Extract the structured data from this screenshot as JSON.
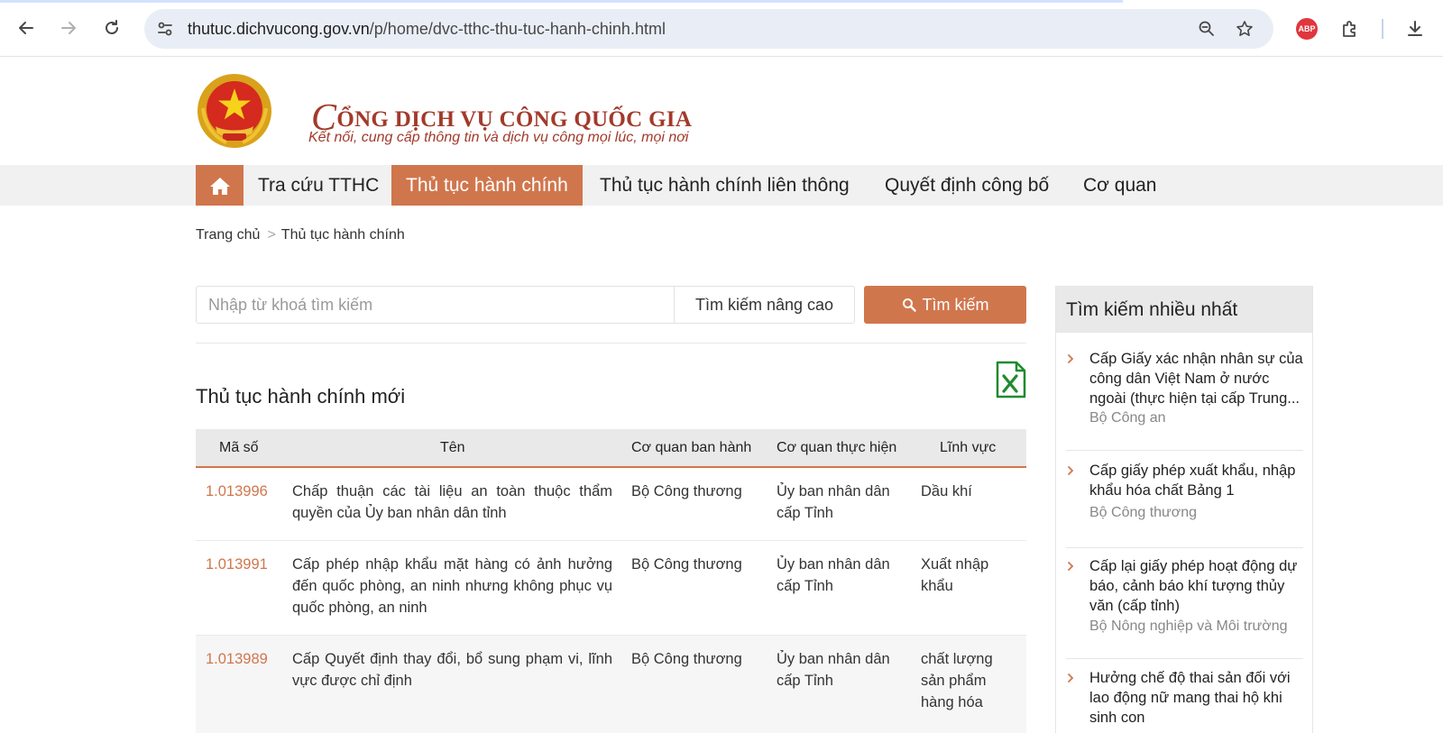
{
  "browser": {
    "url_host": "thutuc.dichvucong.gov.vn",
    "url_path": "/p/home/dvc-tthc-thu-tuc-hanh-chinh.html",
    "extension_badge": "ABP",
    "icons": [
      "back-arrow-icon",
      "forward-arrow-icon",
      "reload-icon",
      "site-info-icon",
      "zoom-icon",
      "bookmark-star-icon",
      "adblock-icon",
      "extensions-puzzle-icon",
      "download-icon"
    ]
  },
  "header": {
    "title_initial": "C",
    "title_rest": "ỔNG DỊCH VỤ CÔNG QUỐC GIA",
    "slogan": "Kết nối, cung cấp thông tin và dịch vụ công mọi lúc, mọi nơi"
  },
  "nav": {
    "items": [
      {
        "label": "Tra cứu TTHC"
      },
      {
        "label": "Thủ tục hành chính",
        "active": true
      },
      {
        "label": "Thủ tục hành chính liên thông"
      },
      {
        "label": "Quyết định công bố"
      },
      {
        "label": "Cơ quan"
      }
    ]
  },
  "breadcrumb": {
    "home": "Trang chủ",
    "separator": ">",
    "current": "Thủ tục hành chính"
  },
  "search": {
    "placeholder": "Nhập từ khoá tìm kiếm",
    "advanced_label": "Tìm kiếm nâng cao",
    "button_label": "Tìm kiếm"
  },
  "section": {
    "title": "Thủ tục hành chính mới"
  },
  "table": {
    "columns": [
      "Mã số",
      "Tên",
      "Cơ quan ban hành",
      "Cơ quan thực hiện",
      "Lĩnh vực"
    ],
    "rows": [
      {
        "code": "1.013996",
        "name": "Chấp thuận các tài liệu an toàn thuộc thẩm quyền của Ủy ban nhân dân tỉnh",
        "issuer": "Bộ Công thương",
        "executor": "Ủy ban nhân dân cấp Tỉnh",
        "field": "Dầu khí"
      },
      {
        "code": "1.013991",
        "name": "Cấp phép nhập khẩu mặt hàng có ảnh hưởng đến quốc phòng, an ninh nhưng không phục vụ quốc phòng, an ninh",
        "issuer": "Bộ Công thương",
        "executor": "Ủy ban nhân dân cấp Tỉnh",
        "field": "Xuất nhập khẩu"
      },
      {
        "code": "1.013989",
        "name": "Cấp Quyết định thay đổi, bổ sung phạm vi, lĩnh vực được chỉ định",
        "issuer": "Bộ Công thương",
        "executor": "Ủy ban nhân dân cấp Tỉnh",
        "field": "chất lượng sản phẩm hàng hóa"
      }
    ]
  },
  "sidebar": {
    "title": "Tìm kiếm nhiều nhất",
    "items": [
      {
        "title": "Cấp Giấy xác nhận nhân sự của công dân Việt Nam ở nước ngoài (thực hiện tại cấp Trung...",
        "agency": "Bộ Công an"
      },
      {
        "title": "Cấp giấy phép xuất khẩu, nhập khẩu hóa chất Bảng 1",
        "agency": "Bộ Công thương"
      },
      {
        "title": "Cấp lại giấy phép hoạt động dự báo, cảnh báo khí tượng thủy văn (cấp tỉnh)",
        "agency": "Bộ Nông nghiệp và Môi trường"
      },
      {
        "title": "Hưởng chế độ thai sản đối với lao động nữ mang thai hộ khi sinh con",
        "agency": ""
      }
    ]
  },
  "colors": {
    "accent": "#d0764d",
    "brand_red": "#a23a2a",
    "excel_green": "#1e8b2e"
  }
}
